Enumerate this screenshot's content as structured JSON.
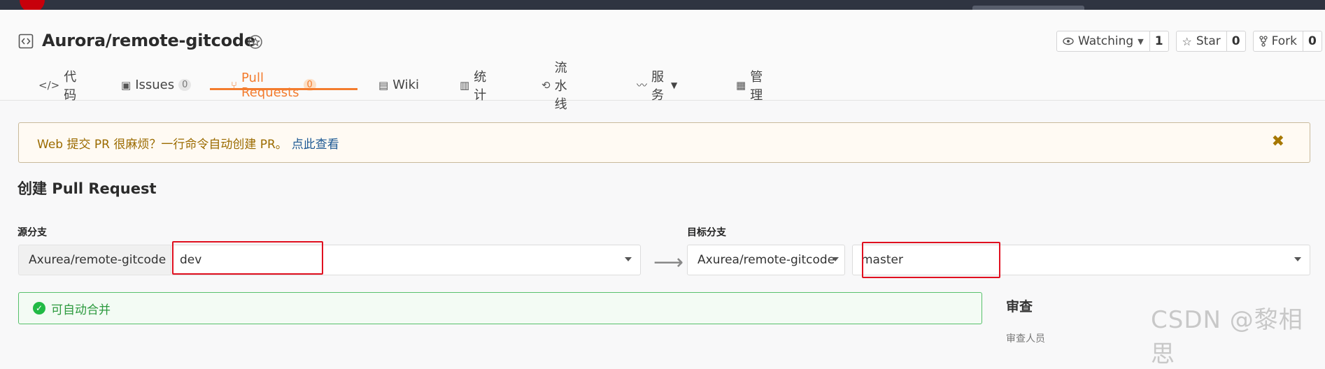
{
  "repo": {
    "title": "Aurora/remote-gitcode"
  },
  "actions": {
    "watching": {
      "label": "Watching",
      "count": "1"
    },
    "star": {
      "label": "Star",
      "count": "0"
    },
    "fork": {
      "label": "Fork",
      "count": "0"
    }
  },
  "tabs": [
    {
      "label": "代码",
      "icon": "code-icon"
    },
    {
      "label": "Issues",
      "count": "0",
      "icon": "issues-icon"
    },
    {
      "label": "Pull Requests",
      "count": "0",
      "icon": "pull-request-icon",
      "active": true
    },
    {
      "label": "Wiki",
      "icon": "book-icon"
    },
    {
      "label": "统计",
      "icon": "bar-chart-icon"
    },
    {
      "label": "流水线",
      "icon": "pipeline-icon"
    },
    {
      "label": "服务",
      "icon": "pulse-icon"
    },
    {
      "label": "管理",
      "icon": "settings-doc-icon"
    }
  ],
  "banner": {
    "text": "Web 提交 PR 很麻烦？一行命令自动创建 PR。",
    "link": "点此查看"
  },
  "page_title": "创建 Pull Request",
  "source": {
    "label": "源分支",
    "repo": "Axurea/remote-gitcode",
    "branch": "dev"
  },
  "target": {
    "label": "目标分支",
    "repo": "Axurea/remote-gitcode",
    "branch": "master"
  },
  "merge_status": "可自动合并",
  "sidebar": {
    "title": "审查",
    "subtitle": "审查人员"
  },
  "watermark": "CSDN @黎相思",
  "colors": {
    "accent": "#f37c2e",
    "success": "#21ba45",
    "highlight": "#e01020"
  }
}
